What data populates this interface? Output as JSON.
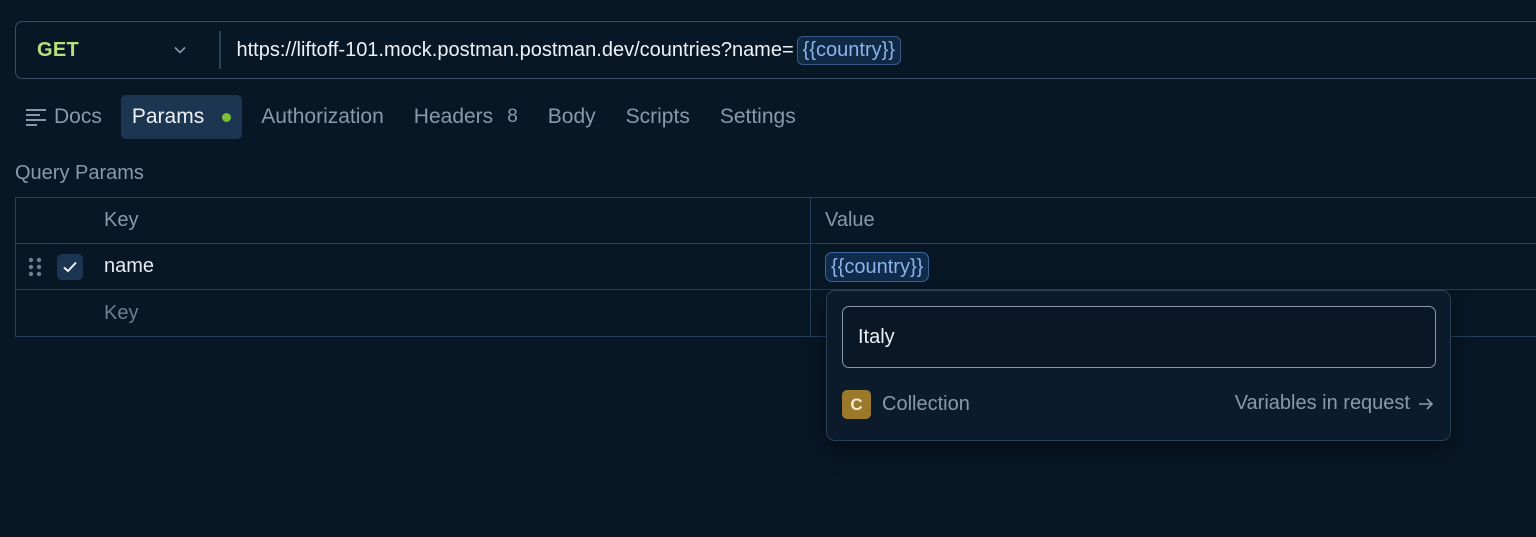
{
  "request": {
    "method": "GET",
    "url_base": "https://liftoff-101.mock.postman.postman.dev/countries?name=",
    "url_variable": "{{country}}"
  },
  "tabs": [
    {
      "label": "Docs",
      "icon": "docs-icon"
    },
    {
      "label": "Params",
      "active": true,
      "indicator": "green-dot"
    },
    {
      "label": "Authorization"
    },
    {
      "label": "Headers",
      "count": "8"
    },
    {
      "label": "Body"
    },
    {
      "label": "Scripts"
    },
    {
      "label": "Settings"
    }
  ],
  "params": {
    "section_title": "Query Params",
    "columns": [
      "Key",
      "Value"
    ],
    "rows": [
      {
        "key": "name",
        "value": "{{country}}",
        "checked": true
      }
    ],
    "new_row_placeholder": "Key"
  },
  "variable_popover": {
    "input_value": "Italy",
    "scope_badge": "C",
    "scope_label": "Collection",
    "link_label": "Variables in request"
  },
  "colors": {
    "background": "#081726",
    "method_get": "#b8e07c",
    "variable": "#8fb2ea",
    "active_tab_bg": "#1c3551",
    "indicator_dot": "#7cbf3a",
    "collection_badge": "#9a7a2a"
  }
}
